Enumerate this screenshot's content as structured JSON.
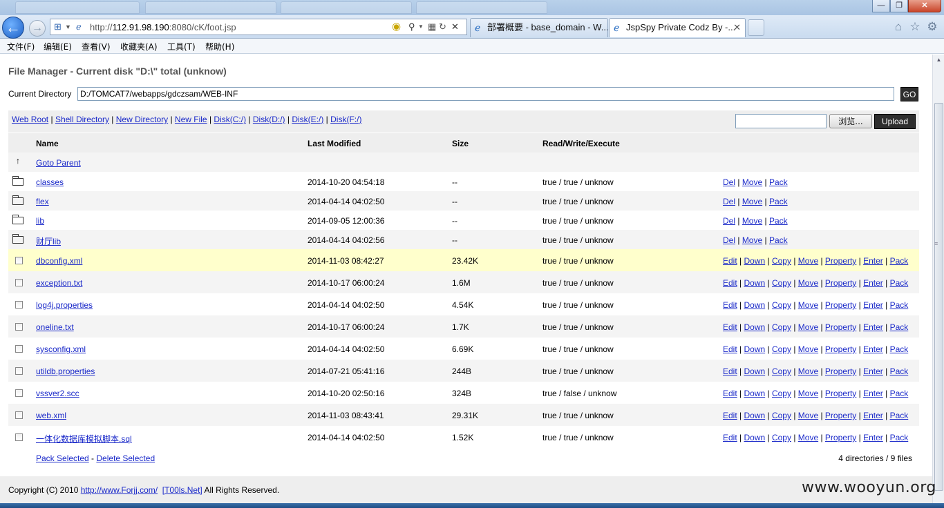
{
  "browser": {
    "address_prefix": "http://",
    "address_host": "112.91.98.190",
    "address_rest": ":8080/cK/foot.jsp",
    "tabs": [
      {
        "label": "部署概要 - base_domain - W...",
        "active": false
      },
      {
        "label": "JspSpy Private Codz By -...",
        "active": true
      }
    ],
    "menu": [
      "文件(F)",
      "编辑(E)",
      "查看(V)",
      "收藏夹(A)",
      "工具(T)",
      "帮助(H)"
    ],
    "icons": {
      "back": "back-arrow-icon",
      "forward": "forward-arrow-icon",
      "home": "home-icon",
      "favorites": "star-icon",
      "tools": "gear-icon"
    }
  },
  "page": {
    "title": "File Manager - Current disk \"D:\\\" total (unknow)",
    "current_directory_label": "Current Directory",
    "current_directory_value": "D:/TOMCAT7/webapps/gdczsam/WEB-INF",
    "go_label": "GO",
    "quick_links": [
      "Web Root",
      "Shell Directory",
      "New Directory",
      "New File",
      "Disk(C:/)",
      "Disk(D:/)",
      "Disk(E:/)",
      "Disk(F:/)"
    ],
    "browse_label": "浏览...",
    "upload_label": "Upload",
    "columns": {
      "name": "Name",
      "modified": "Last Modified",
      "size": "Size",
      "rwx": "Read/Write/Execute"
    },
    "goto_parent": "Goto Parent",
    "dir_actions": [
      "Del",
      "Move",
      "Pack"
    ],
    "file_actions": [
      "Edit",
      "Down",
      "Copy",
      "Move",
      "Property",
      "Enter",
      "Pack"
    ],
    "directories": [
      {
        "name": "classes",
        "modified": "2014-10-20 04:54:18",
        "size": "--",
        "rwx": "true / true / unknow"
      },
      {
        "name": "flex",
        "modified": "2014-04-14 04:02:50",
        "size": "--",
        "rwx": "true / true / unknow"
      },
      {
        "name": "lib",
        "modified": "2014-09-05 12:00:36",
        "size": "--",
        "rwx": "true / true / unknow"
      },
      {
        "name": "财厅lib",
        "modified": "2014-04-14 04:02:56",
        "size": "--",
        "rwx": "true / true / unknow"
      }
    ],
    "files": [
      {
        "name": "dbconfig.xml",
        "modified": "2014-11-03 08:42:27",
        "size": "23.42K",
        "rwx": "true / true / unknow",
        "highlight": true
      },
      {
        "name": "exception.txt",
        "modified": "2014-10-17 06:00:24",
        "size": "1.6M",
        "rwx": "true / true / unknow"
      },
      {
        "name": "log4j.properties",
        "modified": "2014-04-14 04:02:50",
        "size": "4.54K",
        "rwx": "true / true / unknow"
      },
      {
        "name": "oneline.txt",
        "modified": "2014-10-17 06:00:24",
        "size": "1.7K",
        "rwx": "true / true / unknow"
      },
      {
        "name": "sysconfig.xml",
        "modified": "2014-04-14 04:02:50",
        "size": "6.69K",
        "rwx": "true / true / unknow"
      },
      {
        "name": "utildb.properties",
        "modified": "2014-07-21 05:41:16",
        "size": "244B",
        "rwx": "true / true / unknow"
      },
      {
        "name": "vssver2.scc",
        "modified": "2014-10-20 02:50:16",
        "size": "324B",
        "rwx": "true / false / unknow"
      },
      {
        "name": "web.xml",
        "modified": "2014-11-03 08:43:41",
        "size": "29.31K",
        "rwx": "true / true / unknow"
      },
      {
        "name": "一体化数据库模拟脚本.sql",
        "modified": "2014-04-14 04:02:50",
        "size": "1.52K",
        "rwx": "true / true / unknow"
      }
    ],
    "pack_selected": "Pack Selected",
    "separator_dash": " - ",
    "delete_selected": "Delete Selected",
    "file_count": "4 directories / 9 files",
    "copyright_prefix": "Copyright (C) 2010 ",
    "copyright_link1": "http://www.Forjj.com/",
    "copyright_link2": "[T00ls.Net]",
    "copyright_suffix": " All Rights Reserved."
  },
  "watermark": "www.wooyun.org",
  "colors": {
    "link": "#1a29c9",
    "highlight_row": "#ffffcc",
    "dark_button": "#2e2e2e"
  }
}
